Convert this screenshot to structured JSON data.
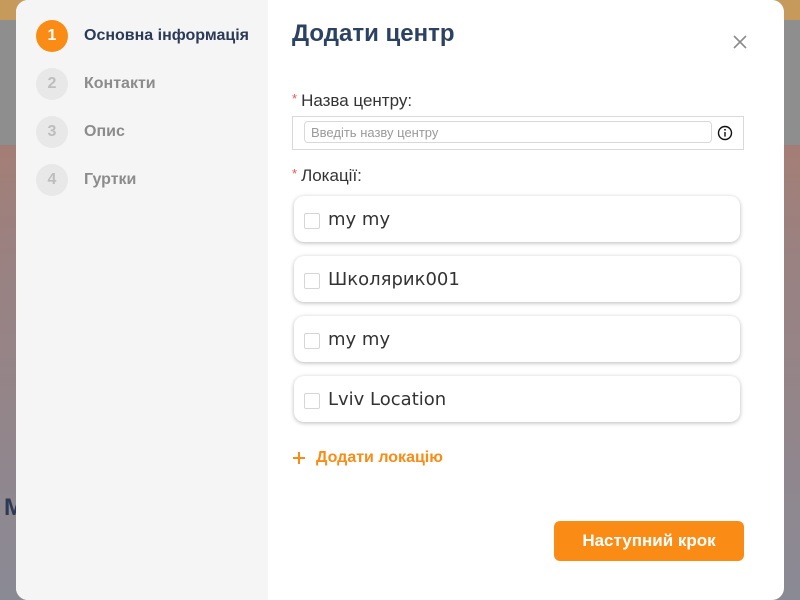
{
  "background": {
    "partial_letter": "M"
  },
  "steps": [
    {
      "number": "1",
      "label": "Основна інформація",
      "active": true
    },
    {
      "number": "2",
      "label": "Контакти",
      "active": false
    },
    {
      "number": "3",
      "label": "Опис",
      "active": false
    },
    {
      "number": "4",
      "label": "Гуртки",
      "active": false
    }
  ],
  "dialog": {
    "title": "Додати центр",
    "close_icon": "close-icon"
  },
  "form": {
    "required_mark": "*",
    "name": {
      "label": "Назва центру:",
      "placeholder": "Введіть назву центру",
      "value": "",
      "icon": "info-icon"
    },
    "locations": {
      "label": "Локації:",
      "items": [
        {
          "label": "my my",
          "checked": false
        },
        {
          "label": "Школярик001",
          "checked": false
        },
        {
          "label": "my my",
          "checked": false
        },
        {
          "label": "Lviv Location",
          "checked": false
        }
      ],
      "add_label": "Додати локацію"
    }
  },
  "footer": {
    "next_label": "Наступний крок"
  },
  "colors": {
    "accent": "#fa8c16",
    "title": "#2c4262",
    "required": "#ff4d4f",
    "sidebar_bg": "#f5f5f5"
  }
}
